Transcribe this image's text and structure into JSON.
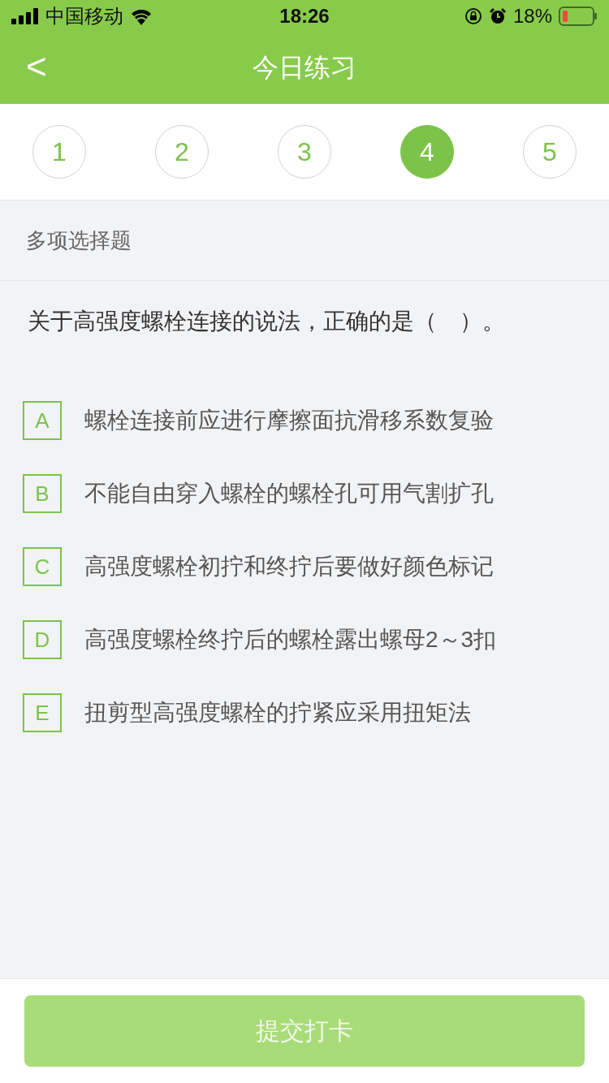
{
  "status_bar": {
    "carrier": "中国移动",
    "time": "18:26",
    "battery": "18%"
  },
  "nav": {
    "back": "<",
    "title": "今日练习"
  },
  "steps": [
    {
      "label": "1",
      "selected": false
    },
    {
      "label": "2",
      "selected": false
    },
    {
      "label": "3",
      "selected": false
    },
    {
      "label": "4",
      "selected": true
    },
    {
      "label": "5",
      "selected": false
    }
  ],
  "question": {
    "type": "多项选择题",
    "text": "关于高强度螺栓连接的说法，正确的是（　）。",
    "options": [
      {
        "letter": "A",
        "text": "螺栓连接前应进行摩擦面抗滑移系数复验",
        "selected": false
      },
      {
        "letter": "B",
        "text": "不能自由穿入螺栓的螺栓孔可用气割扩孔",
        "selected": false
      },
      {
        "letter": "C",
        "text": "高强度螺栓初拧和终拧后要做好颜色标记",
        "selected": false
      },
      {
        "letter": "D",
        "text": "高强度螺栓终拧后的螺栓露出螺母2～3扣",
        "selected": false
      },
      {
        "letter": "E",
        "text": "扭剪型高强度螺栓的拧紧应采用扭矩法",
        "selected": false
      }
    ]
  },
  "submit": {
    "label": "提交打卡",
    "disabled": true
  }
}
